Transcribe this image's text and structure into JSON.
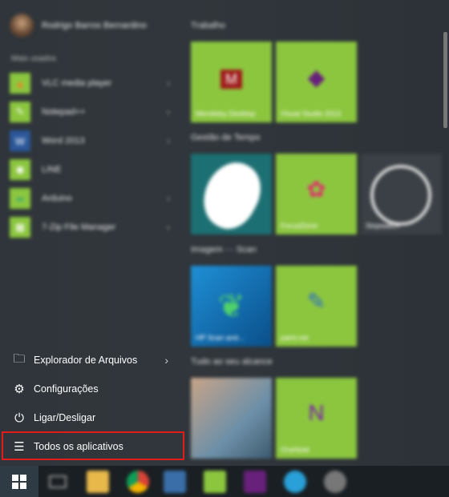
{
  "user": {
    "name": "Rodrigo Barros Bernardino"
  },
  "most_used": {
    "label": "Mais usados",
    "apps": [
      {
        "label": "VLC media player",
        "icon": "vlc-icon",
        "glyph": "▲",
        "has_arrow": true
      },
      {
        "label": "Notepad++",
        "icon": "notepad-plus-icon",
        "glyph": "✎",
        "has_arrow": true
      },
      {
        "label": "Word 2013",
        "icon": "word-icon",
        "glyph": "W",
        "has_arrow": true
      },
      {
        "label": "LINE",
        "icon": "line-icon",
        "glyph": "◉",
        "has_arrow": false
      },
      {
        "label": "Arduino",
        "icon": "arduino-icon",
        "glyph": "∞",
        "has_arrow": true
      },
      {
        "label": "7-Zip File Manager",
        "icon": "7zip-icon",
        "glyph": "▦",
        "has_arrow": true
      }
    ]
  },
  "menu": {
    "file_explorer": "Explorador de Arquivos",
    "settings": "Configurações",
    "power": "Ligar/Desligar",
    "all_apps": "Todos os aplicativos"
  },
  "groups": {
    "work": "Trabalho",
    "time": "Gestão de Tempo",
    "image": "Imagem ··· Scan",
    "everything": "Tudo ao seu alcance"
  },
  "tiles": {
    "mendeley": "Mendeley Desktop",
    "visual_studio": "Visual Studio 2013",
    "focus": "FocusDone",
    "stopwatch": "Stopwatch",
    "hp_scan": "HP Scan and...",
    "paint": "paint.net",
    "onenote": "OneNote"
  },
  "colors": {
    "tile_green": "#8cc63f",
    "highlight_red": "#e21b1b"
  }
}
